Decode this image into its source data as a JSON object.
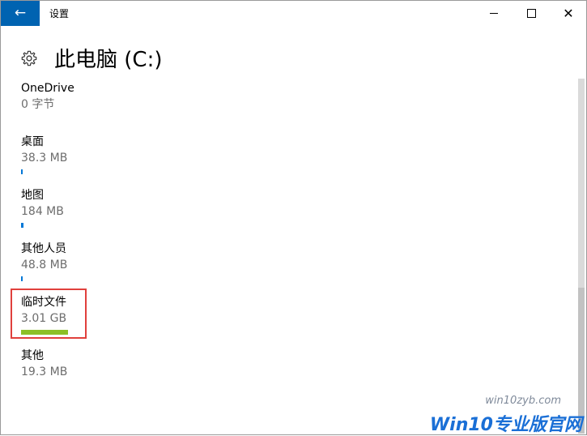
{
  "window": {
    "title": "设置",
    "back_icon": "←",
    "close_icon": "✕",
    "accent": "#0063b1"
  },
  "header": {
    "title": "此电脑 (C:)",
    "icon": "gear-icon"
  },
  "items": [
    {
      "name": "OneDrive",
      "size": "0 字节",
      "bar_fraction": 0,
      "bar_color": "#0078d7"
    },
    {
      "name": "桌面",
      "size": "38.3 MB",
      "bar_fraction": 0.02,
      "bar_color": "#0078d7"
    },
    {
      "name": "地图",
      "size": "184 MB",
      "bar_fraction": 0.06,
      "bar_color": "#0078d7"
    },
    {
      "name": "其他人员",
      "size": "48.8 MB",
      "bar_fraction": 0.02,
      "bar_color": "#0078d7"
    },
    {
      "name": "临时文件",
      "size": "3.01 GB",
      "bar_fraction": 1.0,
      "bar_color": "#8cbf26"
    },
    {
      "name": "其他",
      "size": "19.3 MB",
      "bar_fraction": 0,
      "bar_color": "#0078d7"
    }
  ],
  "watermark": {
    "domain": "win10zyb.com",
    "brand": "Win10专业版官网"
  }
}
